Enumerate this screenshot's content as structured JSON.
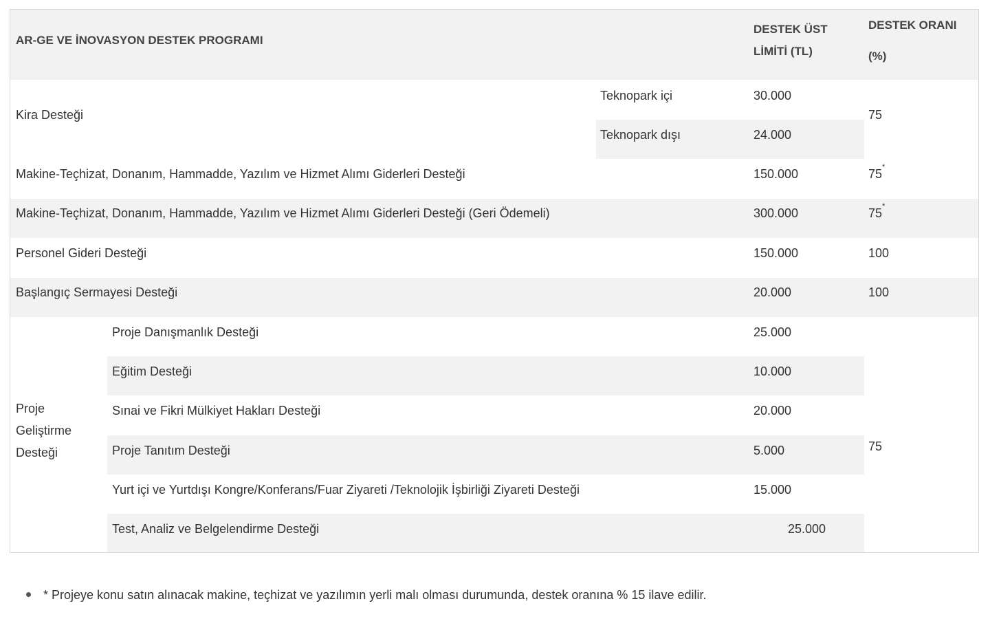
{
  "header": {
    "program": "AR-GE VE İNOVASYON DESTEK PROGRAMI",
    "limit_line1": "DESTEK ÜST",
    "limit_line2": "LİMİTİ (TL)",
    "rate_line1": "DESTEK ORANI",
    "rate_line2": "(%)"
  },
  "kira": {
    "label": "Kira Desteği",
    "sub1": "Teknopark içi",
    "limit1": "30.000",
    "sub2": "Teknopark dışı",
    "limit2": "24.000",
    "rate": "75"
  },
  "rows": [
    {
      "label": "Makine-Teçhizat, Donanım, Hammadde, Yazılım ve Hizmet Alımı Giderleri Desteği",
      "limit": "150.000",
      "rate": "75",
      "mark": "*"
    },
    {
      "label": "Makine-Teçhizat, Donanım, Hammadde, Yazılım ve Hizmet Alımı Giderleri Desteği (Geri Ödemeli)",
      "limit": "300.000",
      "rate": "75",
      "mark": "*"
    },
    {
      "label": "Personel Gideri Desteği",
      "limit": "150.000",
      "rate": "100"
    },
    {
      "label": "Başlangıç Sermayesi Desteği",
      "limit": "20.000",
      "rate": "100"
    }
  ],
  "proje": {
    "label_line1": "Proje",
    "label_line2": "Geliştirme",
    "label_line3": "Desteği",
    "rate": "75",
    "items": [
      {
        "label": "Proje Danışmanlık Desteği",
        "limit": "25.000"
      },
      {
        "label": "Eğitim Desteği",
        "limit": "10.000"
      },
      {
        "label": "Sınai ve Fikri Mülkiyet Hakları Desteği",
        "limit": "20.000"
      },
      {
        "label": "Proje Tanıtım Desteği",
        "limit": "5.000"
      },
      {
        "label": "Yurt içi ve Yurtdışı Kongre/Konferans/Fuar Ziyareti /Teknolojik İşbirliği Ziyareti Desteği",
        "limit": "15.000"
      },
      {
        "label": "Test, Analiz ve Belgelendirme Desteği",
        "limit": "25.000"
      }
    ]
  },
  "footnote": "* Projeye konu satın alınacak makine, teçhizat ve yazılımın yerli malı olması durumunda, destek oranına % 15 ilave edilir."
}
